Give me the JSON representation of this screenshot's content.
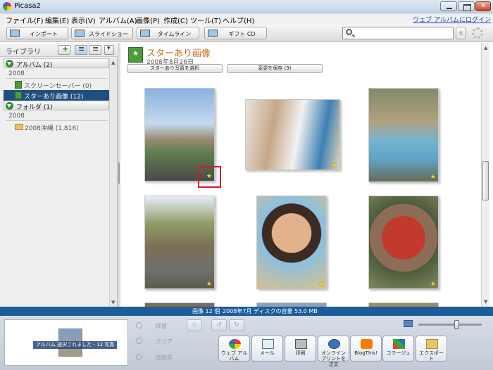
{
  "window": {
    "title": "Picasa2"
  },
  "menu": {
    "items": [
      "ファイル(F)",
      "編集(E)",
      "表示(V)",
      "アルバム(A)",
      "画像(P)",
      "作成(C)",
      "ツール(T)",
      "ヘルプ(H)"
    ],
    "web_link": "ウェブ アルバムにログイン"
  },
  "toolbar": {
    "import": "インポート",
    "slideshow": "スライドショー",
    "timeline": "タイムライン",
    "giftcd": "ギフト CD"
  },
  "library": {
    "label": "ライブラリ",
    "albums_section": "アルバム (2)",
    "albums_year": "2008",
    "albums": [
      {
        "label": "スクリーンセーバー (0)"
      },
      {
        "label": "スターあり画像 (12)",
        "selected": true
      }
    ],
    "folders_section": "フォルダ (1)",
    "folders_year": "2008",
    "folders": [
      {
        "label": "2008沖縄 (1,816)"
      }
    ]
  },
  "album": {
    "title": "スターあり画像",
    "date": "2008年8月26日",
    "select_starred": "スターあり写真を選択",
    "save_changes": "変更を保存 (9)"
  },
  "status": {
    "count": "画像 12 個",
    "date": "2008年7月",
    "disk": "ディスクの容量 53.0 MB"
  },
  "tray": {
    "label": "アルバム 選択されました - 12 写真",
    "hold": "保留",
    "clear": "クリア",
    "add_to": "追加先"
  },
  "actions": [
    {
      "label": "ウェブ アルバム",
      "icon": "web-album-icon"
    },
    {
      "label": "メール",
      "icon": "mail-icon"
    },
    {
      "label": "印刷",
      "icon": "print-icon"
    },
    {
      "label": "オンラインプリントを注文",
      "icon": "online-print-icon"
    },
    {
      "label": "BlogThis!",
      "icon": "blogger-icon"
    },
    {
      "label": "コラージュ",
      "icon": "collage-icon"
    },
    {
      "label": "エクスポート",
      "icon": "export-icon"
    }
  ],
  "colors": {
    "accent": "#1e4f7e",
    "status_bar": "#1d5c9b",
    "album_title": "#c66a17",
    "star": "#ffd21a",
    "highlight": "#e0191f"
  }
}
